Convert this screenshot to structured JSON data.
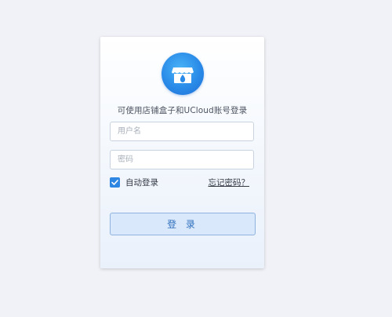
{
  "login": {
    "subtitle": "可使用店铺盒子和UCloud账号登录",
    "username_placeholder": "用户名",
    "password_placeholder": "密码",
    "remember_label": "自动登录",
    "remember_checked": true,
    "forgot_label": "忘记密码？",
    "submit_label": "登 录"
  },
  "colors": {
    "page_background": "#f1f2f7",
    "accent": "#2e86e3",
    "button_background": "#d9e8fa",
    "button_border": "#8fb2de",
    "button_text": "#2f6fbd"
  },
  "icons": {
    "logo": "store-icon",
    "checkbox": "check-icon"
  }
}
